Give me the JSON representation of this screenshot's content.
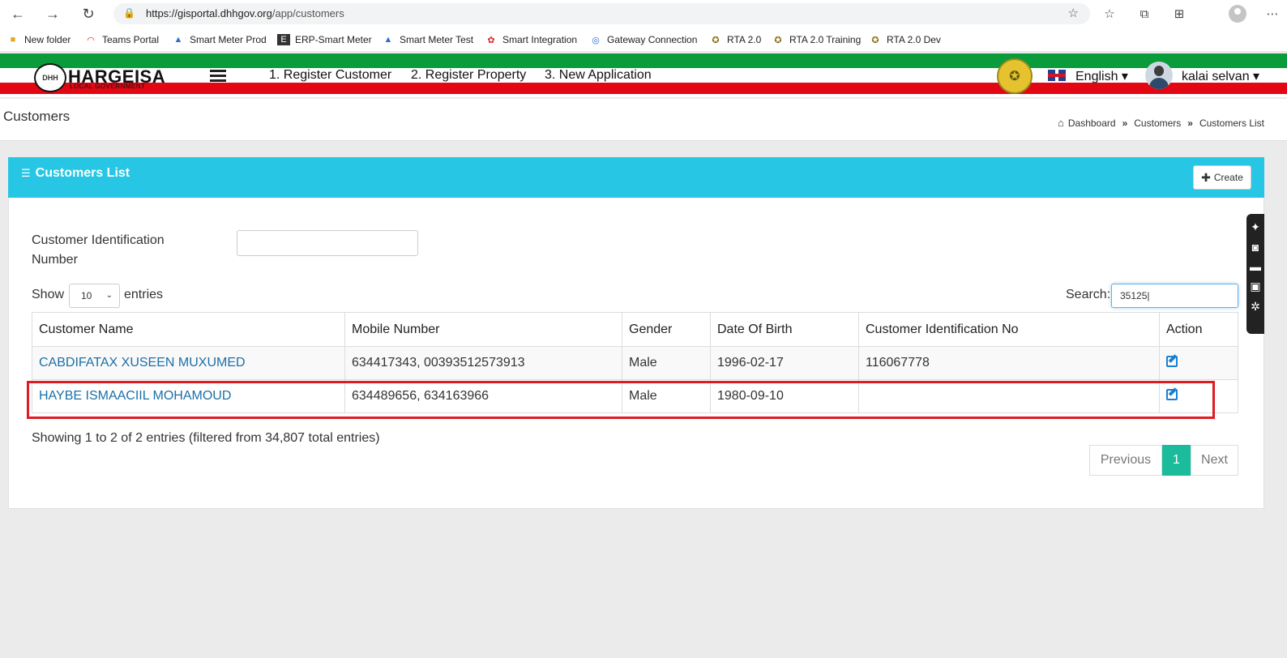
{
  "browser": {
    "url_host": "https://gisportal.dhhgov.org",
    "url_path": "/app/customers",
    "bookmarks": [
      "New folder",
      "Teams Portal",
      "Smart Meter Prod",
      "ERP-Smart Meter",
      "Smart Meter Test",
      "Smart Integration",
      "Gateway Connection",
      "RTA 2.0",
      "RTA 2.0 Training",
      "RTA 2.0 Dev"
    ]
  },
  "header": {
    "logo_mark": "DHH",
    "logo_text": "HARGEISA",
    "logo_sub": "LOCAL GOVERNMENT",
    "nav": [
      "1. Register Customer",
      "2. Register Property",
      "3. New Application"
    ],
    "language": "English ▾",
    "user": "kalai selvan ▾"
  },
  "page": {
    "title": "Customers",
    "breadcrumb": [
      "Dashboard",
      "Customers",
      "Customers List"
    ]
  },
  "panel": {
    "title": "Customers List",
    "create_label": "Create"
  },
  "filters": {
    "cin_label": "Customer Identification Number",
    "cin_value": "",
    "show_label": "Show",
    "show_value": "10",
    "entries_label": "entries",
    "search_label": "Search:",
    "search_value": "35125|"
  },
  "table": {
    "columns": [
      "Customer Name",
      "Mobile Number",
      "Gender",
      "Date Of Birth",
      "Customer Identification No",
      "Action"
    ],
    "rows": [
      {
        "name": "CABDIFATAX XUSEEN MUXUMED",
        "mobile": "634417343, 00393512573913",
        "gender": "Male",
        "dob": "1996-02-17",
        "cin": "116067778"
      },
      {
        "name": "HAYBE ISMAACIIL MOHAMOUD",
        "mobile": "634489656, 634163966",
        "gender": "Male",
        "dob": "1980-09-10",
        "cin": ""
      }
    ]
  },
  "footer": {
    "info": "Showing 1 to 2 of 2 entries (filtered from 34,807 total entries)",
    "prev": "Previous",
    "page": "1",
    "next": "Next"
  },
  "colors": {
    "panel_header": "#26c6e4",
    "stripe_green": "#0a9b3a",
    "stripe_red": "#e30613",
    "link": "#1b6fa8",
    "page_active": "#1abc9c",
    "highlight": "#e01b24"
  }
}
